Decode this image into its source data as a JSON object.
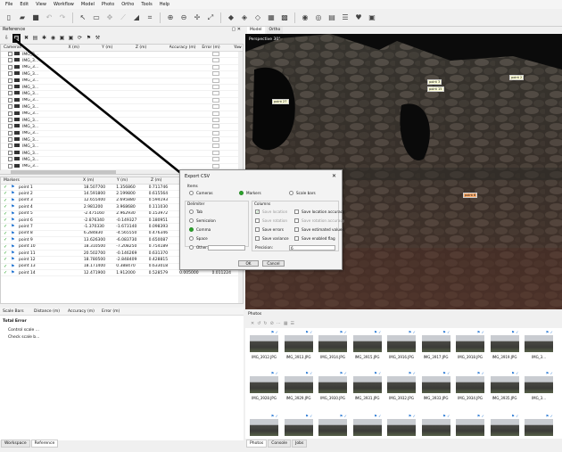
{
  "menu": [
    "File",
    "Edit",
    "View",
    "Workflow",
    "Model",
    "Photo",
    "Ortho",
    "Tools",
    "Help"
  ],
  "panes": {
    "reference_title": "Reference",
    "workspace_tab": "Workspace",
    "reference_tab": "Reference"
  },
  "cameras_table": {
    "headers": [
      "Cameras",
      "X (m)",
      "Y (m)",
      "Z (m)",
      "Accuracy (m)",
      "Error (m)",
      "Yaw (°)"
    ],
    "rows": [
      "IMG_3...",
      "IMG_3...",
      "IMG_3...",
      "IMG_3...",
      "IMG_3...",
      "IMG_3...",
      "IMG_3...",
      "IMG_3...",
      "IMG_3...",
      "IMG_3...",
      "IMG_3...",
      "IMG_3...",
      "IMG_3...",
      "IMG_3...",
      "IMG_3...",
      "IMG_3...",
      "IMG_3...",
      "IMG_3..."
    ]
  },
  "markers_table": {
    "headers": [
      "Markers",
      "X (m)",
      "Y (m)",
      "Z (m)"
    ],
    "rows": [
      [
        "point 1",
        "18.507700",
        "1.356860",
        "0.711746",
        "",
        ""
      ],
      [
        "point 2",
        "14.591800",
        "2.199800",
        "0.615564",
        "",
        ""
      ],
      [
        "point 3",
        "12.655400",
        "2.695880",
        "0.594193",
        "",
        ""
      ],
      [
        "point 4",
        "2.981200",
        "3.968680",
        "0.111030",
        "",
        ""
      ],
      [
        "point 5",
        "-2.475160",
        "2.962930",
        "0.153972",
        "",
        ""
      ],
      [
        "point 6",
        "-2.876340",
        "-0.149327",
        "0.180951",
        "",
        ""
      ],
      [
        "point 7",
        "-1.370330",
        "-1.673140",
        "0.098393",
        "",
        ""
      ],
      [
        "point 8",
        "6.284830",
        "-4.565550",
        "0.476346",
        "",
        ""
      ],
      [
        "point 9",
        "13.626300",
        "-6.083730",
        "0.650087",
        "",
        ""
      ],
      [
        "point 10",
        "18.310500",
        "-7.208250",
        "0.754189",
        "",
        ""
      ],
      [
        "point 11",
        "20.502700",
        "-0.146269",
        "0.631370",
        "",
        ""
      ],
      [
        "point 12",
        "18.780500",
        "-2.848409",
        "0.428815",
        "0.005000",
        "0.014904"
      ],
      [
        "point 13",
        "18.171400",
        "0.388470",
        "0.633018",
        "0.005000",
        "0.015964"
      ],
      [
        "point 14",
        "12.471900",
        "1.912000",
        "0.528579",
        "0.005000",
        "0.011224"
      ]
    ]
  },
  "scalebars_header": [
    "Scale Bars",
    "Distance (m)",
    "Accuracy (m)",
    "Error (m)"
  ],
  "total_error": {
    "title": "Total Error",
    "control": "Control scale ...",
    "check": "Check scale b..."
  },
  "model": {
    "tabs": [
      "Model",
      "Ortho"
    ],
    "perspective": "Perspective 30°",
    "labels": [
      "point 2",
      "point 3",
      "point 15",
      "point 27",
      "point 6"
    ]
  },
  "photos": {
    "title": "Photos",
    "row1": [
      "IMG_3912.JPG",
      "IMG_3913.JPG",
      "IMG_3914.JPG",
      "IMG_3915.JPG",
      "IMG_3916.JPG",
      "IMG_3917.JPG",
      "IMG_3918.JPG",
      "IMG_3919.JPG",
      "IMG_3..."
    ],
    "row2": [
      "IMG_3928.JPG",
      "IMG_3929.JPG",
      "IMG_3930.JPG",
      "IMG_3931.JPG",
      "IMG_3932.JPG",
      "IMG_3933.JPG",
      "IMG_3934.JPG",
      "IMG_3935.JPG",
      "IMG_3..."
    ],
    "bottom_tabs": [
      "Photos",
      "Console",
      "Jobs"
    ]
  },
  "dialog": {
    "title": "Export CSV",
    "items_label": "Items",
    "items": [
      "Cameras",
      "Markers",
      "Scale bars"
    ],
    "delimiter_label": "Delimiter",
    "delimiters": [
      "Tab",
      "Semicolon",
      "Comma",
      "Space",
      "Other:"
    ],
    "columns_label": "Columns",
    "columns_left": [
      "Save location",
      "Save rotation",
      "Save errors",
      "Save variance"
    ],
    "columns_right": [
      "Save location accuracy",
      "Save rotation accuracy",
      "Save estimated values",
      "Save enabled flag"
    ],
    "precision_label": "Precision:",
    "precision_value": "6",
    "ok": "OK",
    "cancel": "Cancel"
  }
}
